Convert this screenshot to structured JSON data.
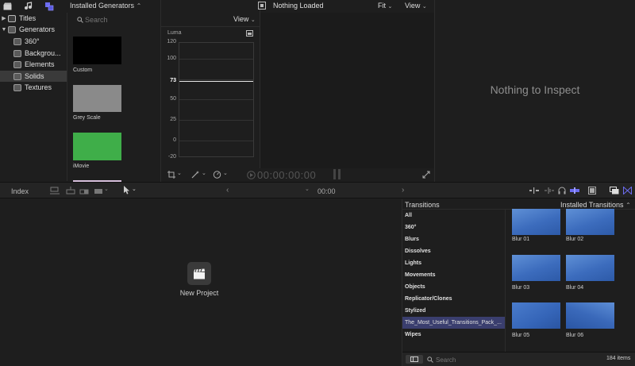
{
  "top": {
    "generators_dropdown": "Installed Generators",
    "viewer_view_label": "View",
    "viewer_title": "Nothing Loaded",
    "viewer_zoom": "Fit",
    "viewer_view2": "View"
  },
  "sidebar": {
    "items": [
      {
        "label": "Titles"
      },
      {
        "label": "Generators"
      },
      {
        "label": "360°"
      },
      {
        "label": "Backgrou..."
      },
      {
        "label": "Elements"
      },
      {
        "label": "Solids"
      },
      {
        "label": "Textures"
      }
    ]
  },
  "browser": {
    "search_placeholder": "Search",
    "thumbs": [
      {
        "label": "Custom"
      },
      {
        "label": "Grey Scale"
      },
      {
        "label": "iMovie"
      }
    ]
  },
  "scope": {
    "label": "Luma",
    "ticks": [
      "120",
      "100",
      "75",
      "73",
      "50",
      "25",
      "0",
      "-20"
    ],
    "value": 73
  },
  "timecode": "00:00:00:00",
  "inspector": {
    "empty_text": "Nothing to Inspect"
  },
  "timeline": {
    "index_label": "Index",
    "time": "00:00",
    "new_project": "New Project"
  },
  "transitions": {
    "header": "Transitions",
    "source_dropdown": "Installed Transitions",
    "categories": [
      {
        "label": "All"
      },
      {
        "label": "360°"
      },
      {
        "label": "Blurs"
      },
      {
        "label": "Dissolves"
      },
      {
        "label": "Lights"
      },
      {
        "label": "Movements"
      },
      {
        "label": "Objects"
      },
      {
        "label": "Replicator/Clones"
      },
      {
        "label": "Stylized"
      },
      {
        "label": "The_Most_Useful_Transitions_Pack_..."
      },
      {
        "label": "Wipes"
      }
    ],
    "thumbs": [
      {
        "label": "Blur 01"
      },
      {
        "label": "Blur 02"
      },
      {
        "label": "Blur 03"
      },
      {
        "label": "Blur 04"
      },
      {
        "label": "Blur 05"
      },
      {
        "label": "Blur 06"
      }
    ],
    "search_placeholder": "Search",
    "count": "184 items"
  },
  "colors": {
    "accent": "#6c6cf0",
    "selection": "#3a3e6e",
    "green_solid": "#3fae49",
    "grey_solid": "#8a8a8a"
  }
}
